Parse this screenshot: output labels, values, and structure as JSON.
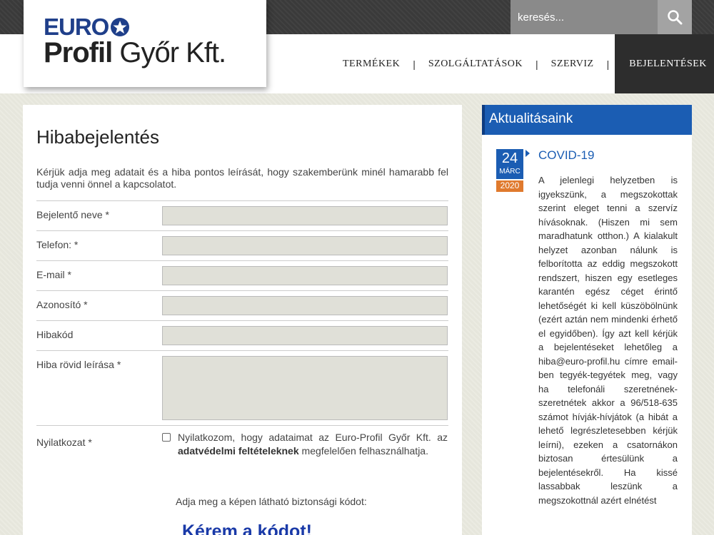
{
  "search": {
    "placeholder": "keresés..."
  },
  "logo": {
    "line1": "EURO",
    "line2_bold": "Profil",
    "line2_rest": " Győr Kft."
  },
  "nav": {
    "items": [
      {
        "label": "TERMÉKEK"
      },
      {
        "label": "SZOLGÁLTATÁSOK"
      },
      {
        "label": "SZERVIZ"
      },
      {
        "label": "BEJELENTÉSEK"
      }
    ],
    "separator": "|"
  },
  "main": {
    "title": "Hibabejelentés",
    "intro": "Kérjük adja meg adatait és a hiba pontos leírását, hogy szakemberünk minél hamarabb fel tudja venni önnel a kapcsolatot.",
    "fields": [
      {
        "label": "Bejelentő neve *"
      },
      {
        "label": "Telefon: *"
      },
      {
        "label": "E-mail *"
      },
      {
        "label": "Azonosító *"
      },
      {
        "label": "Hibakód"
      },
      {
        "label": "Hiba rövid leírása *"
      }
    ],
    "consent": {
      "label": "Nyilatkozat *",
      "text_before": "Nyilatkozom, hogy adataimat az Euro-Profil Győr Kft. az ",
      "link": "adatvédelmi feltételeknek",
      "text_after": " megfelelően felhasználhatja."
    },
    "captcha_label": "Adja meg a képen látható biztonsági kódot:",
    "captcha_image_text": "Kérem a kódot!"
  },
  "sidebar": {
    "title": "Aktualitásaink",
    "news": {
      "day": "24",
      "month": "MÁRC",
      "year": "2020",
      "title": "COVID-19",
      "body": "A jelenlegi helyzetben is igyekszünk, a megszokottak szerint eleget tenni a szervíz hívásoknak. (Hiszen mi sem maradhatunk otthon.) A kialakult helyzet azonban nálunk is felborította az eddig megszokott rendszert, hiszen egy esetleges karantén egész céget érintő lehetőségét ki kell küszöbölnünk (ezért aztán nem mindenki érhető el egyidőben). Így azt kell kérjük a bejelentéseket lehetőleg a hiba@euro-profil.hu címre email-ben tegyék-tegyétek meg, vagy ha telefonáli szeretnének-szeretnétek akkor a 96/518-635 számot hívják-hívjátok (a hibát a lehető legrészletesebben kérjük leírni), ezeken a csatornákon biztosan értesülünk a bejelentésekről. Ha kissé lassabbak leszünk a megszokottnál azért elnétést"
    }
  },
  "colors": {
    "brand_blue": "#1b5db3",
    "accent_orange": "#e07a2e",
    "dark": "#2d2d2d"
  }
}
